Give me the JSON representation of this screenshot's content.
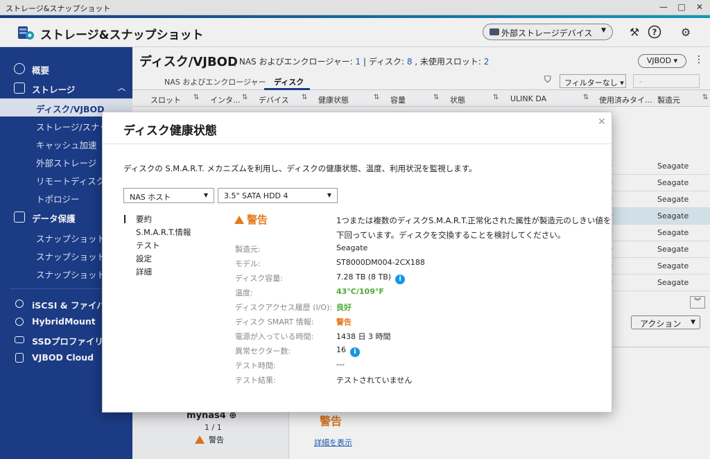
{
  "window": {
    "title": "ストレージ&スナップショット",
    "minimize": "—",
    "maximize": "□",
    "close": "✕"
  },
  "header": {
    "app_title": "ストレージ&スナップショット",
    "ext_device_label": "外部ストレージデバイス",
    "icons": [
      "tools-icon",
      "help-icon",
      "settings-icon"
    ]
  },
  "sidebar": {
    "overview": "概要",
    "storage": "ストレージ",
    "storage_items": [
      "ディスク/VJBOD",
      "ストレージ/スナップ",
      "キャッシュ加速",
      "外部ストレージ",
      "リモートディスク",
      "トポロジー"
    ],
    "data_protection": "データ保護",
    "protection_items": [
      "スナップショット",
      "スナップショットレ",
      "スナップショットオ"
    ],
    "others": [
      "iSCSI & ファイバー",
      "HybridMount",
      "SSDプロファイリ",
      "VJBOD Cloud"
    ]
  },
  "page": {
    "title": "ディスク/VJBOD",
    "stats_prefix": "| NAS およびエンクロージャー: ",
    "nas_count": "1",
    "disk_label": " | ディスク: ",
    "disk_count": "8",
    "unused_label": " , 未使用スロット: ",
    "unused_count": "2",
    "vjbod_btn": "VJBOD",
    "kebab": "⋮",
    "tabs": [
      "NAS およびエンクロージャー",
      "ディスク"
    ],
    "filter": "フィルターなし",
    "filter2": "-"
  },
  "table": {
    "headers": [
      "スロット",
      "インタ...",
      "デバイス",
      "健康状態",
      "容量",
      "状態",
      "ULINK DA",
      "使用済みタイ...",
      "製造元"
    ],
    "rows": [
      {
        "c1": "タ",
        "c2": "Seagate"
      },
      {
        "c1": "タ",
        "c2": "Seagate"
      },
      {
        "c1": "タ",
        "c2": "Seagate"
      },
      {
        "c1": "タ",
        "c2": "Seagate"
      },
      {
        "c1": "タ",
        "c2": "Seagate"
      },
      {
        "c1": "タ",
        "c2": "Seagate"
      },
      {
        "c1": "タ",
        "c2": "Seagate"
      },
      {
        "c1": "タ",
        "c2": "Seagate"
      }
    ],
    "selected_row": 3
  },
  "lower": {
    "nas_name": "mynas4",
    "nas_count": "1 / 1",
    "nas_status": "警告",
    "right_status": "警告",
    "detail_link": "詳細を表示",
    "action": "アクション"
  },
  "modal": {
    "title": "ディスク健康状態",
    "close": "✕",
    "description": "ディスクの S.M.A.R.T. メカニズムを利用し、ディスクの健康状態、温度、利用状況を監視します。",
    "host_select": "NAS ホスト",
    "disk_select": "3.5\" SATA HDD 4",
    "nav": [
      "要約",
      "S.M.A.R.T.情報",
      "テスト",
      "設定",
      "詳細"
    ],
    "status": "警告",
    "message": "1つまたは複数のディスクS.M.A.R.T.正常化された属性が製造元のしきい値を下回っています。ディスクを交換することを検討してください。",
    "properties": [
      {
        "label": "製造元:",
        "value": "Seagate",
        "style": ""
      },
      {
        "label": "モデル:",
        "value": "ST8000DM004-2CX188",
        "style": ""
      },
      {
        "label": "ディスク容量:",
        "value": "7.28 TB (8 TB)",
        "style": "",
        "info": true
      },
      {
        "label": "温度:",
        "value": "43°C/109°F",
        "style": "green"
      },
      {
        "label": "ディスクアクセス履歴 (I/O):",
        "value": "良好",
        "style": "green"
      },
      {
        "label": "ディスク SMART 情報:",
        "value": "警告",
        "style": "orange"
      },
      {
        "label": "電源が入っている時間:",
        "value": "1438 日 3 時間",
        "style": ""
      },
      {
        "label": "異常セクター数:",
        "value": "16",
        "style": "",
        "info": true
      },
      {
        "label": "テスト時間:",
        "value": "---",
        "style": ""
      },
      {
        "label": "テスト結果:",
        "value": "テストされていません",
        "style": ""
      }
    ]
  },
  "colors": {
    "sidebar": "#1d3f8e",
    "warning": "#e37b1b",
    "good": "#4caa34",
    "link": "#1d5fb8"
  }
}
